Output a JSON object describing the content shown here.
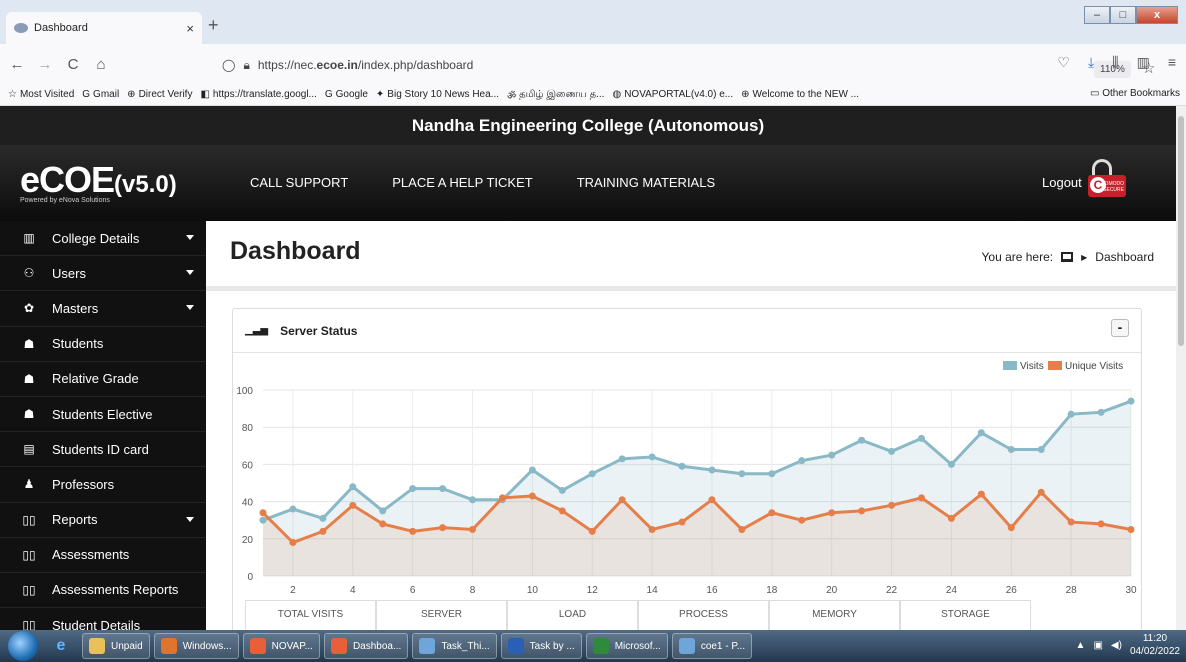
{
  "browser": {
    "tab_title": "Dashboard",
    "tab_close": "×",
    "new_tab": "+",
    "url_prefix": "https://nec.",
    "url_domain": "ecoe.in",
    "url_suffix": "/index.php/dashboard",
    "zoom": "110%",
    "bookmarks": [
      {
        "icon": "☆",
        "label": "Most Visited"
      },
      {
        "icon": "G",
        "label": "Gmail"
      },
      {
        "icon": "⊕",
        "label": "Direct Verify"
      },
      {
        "icon": "◧",
        "label": "https://translate.googl..."
      },
      {
        "icon": "G",
        "label": "Google"
      },
      {
        "icon": "✦",
        "label": "Big Story 10 News Hea..."
      },
      {
        "icon": "ॐ",
        "label": "தமிழ் இணைய த..."
      },
      {
        "icon": "◍",
        "label": "NOVAPORTAL(v4.0) e..."
      },
      {
        "icon": "⊕",
        "label": "Welcome to the NEW ..."
      }
    ],
    "other_bookmarks": "Other Bookmarks"
  },
  "header": {
    "college": "Nandha Engineering College (Autonomous)",
    "brand": "eCOE",
    "version": "(v5.0)",
    "powered": "Powered by eNova Solutions",
    "menu": [
      "CALL SUPPORT",
      "PLACE A HELP TICKET",
      "TRAINING MATERIALS"
    ],
    "logout": "Logout",
    "secure_badge": "COMODO SECURE"
  },
  "sidebar": {
    "items": [
      {
        "icon": "▥",
        "label": "College Details",
        "caret": true
      },
      {
        "icon": "⚇",
        "label": "Users",
        "caret": true
      },
      {
        "icon": "✿",
        "label": "Masters",
        "caret": true
      },
      {
        "icon": "☗",
        "label": "Students",
        "caret": false
      },
      {
        "icon": "☗",
        "label": "Relative Grade",
        "caret": false
      },
      {
        "icon": "☗",
        "label": "Students Elective",
        "caret": false
      },
      {
        "icon": "▤",
        "label": "Students ID card",
        "caret": false
      },
      {
        "icon": "♟",
        "label": "Professors",
        "caret": false
      },
      {
        "icon": "▯▯",
        "label": "Reports",
        "caret": true
      },
      {
        "icon": "▯▯",
        "label": "Assessments",
        "caret": false
      },
      {
        "icon": "▯▯",
        "label": "Assessments Reports",
        "caret": false
      },
      {
        "icon": "▯▯",
        "label": "Student Details",
        "caret": false
      }
    ]
  },
  "main": {
    "title": "Dashboard",
    "breadcrumb_prefix": "You are here:",
    "breadcrumb_current": "Dashboard",
    "panel_title": "Server Status",
    "collapse": "-",
    "stats": [
      "TOTAL VISITS",
      "SERVER",
      "LOAD",
      "PROCESS",
      "MEMORY",
      "STORAGE"
    ]
  },
  "chart_data": {
    "type": "area",
    "x": [
      1,
      2,
      3,
      4,
      5,
      6,
      7,
      8,
      9,
      10,
      11,
      12,
      13,
      14,
      15,
      16,
      17,
      18,
      19,
      20,
      21,
      22,
      23,
      24,
      25,
      26,
      27,
      28,
      29,
      30
    ],
    "series": [
      {
        "name": "Visits",
        "color": "#89b8c6",
        "values": [
          30,
          36,
          31,
          48,
          35,
          47,
          47,
          41,
          41,
          57,
          46,
          55,
          63,
          64,
          59,
          57,
          55,
          55,
          62,
          65,
          73,
          67,
          74,
          60,
          77,
          68,
          68,
          87,
          88,
          94
        ]
      },
      {
        "name": "Unique Visits",
        "color": "#e67e4a",
        "values": [
          34,
          18,
          24,
          38,
          28,
          24,
          26,
          25,
          42,
          43,
          35,
          24,
          41,
          25,
          29,
          41,
          25,
          34,
          30,
          34,
          35,
          38,
          42,
          31,
          44,
          26,
          45,
          29,
          28,
          25
        ]
      }
    ],
    "xticks": [
      2,
      4,
      6,
      8,
      10,
      12,
      14,
      16,
      18,
      20,
      22,
      24,
      26,
      28,
      30
    ],
    "yticks": [
      0,
      20,
      40,
      60,
      80,
      100
    ],
    "ylim": [
      0,
      100
    ],
    "xlim": [
      1,
      30
    ],
    "legend": "top-right",
    "grid": true
  },
  "taskbar": {
    "items": [
      {
        "label": "Unpaid",
        "color": "#e8c15a"
      },
      {
        "label": "Windows...",
        "color": "#e0742b"
      },
      {
        "label": "NOVAP...",
        "color": "#e8603a"
      },
      {
        "label": "Dashboa...",
        "color": "#e8603a"
      },
      {
        "label": "Task_Thi...",
        "color": "#6ea6d9"
      },
      {
        "label": "Task by ...",
        "color": "#2b5fb5"
      },
      {
        "label": "Microsof...",
        "color": "#2e8b3c"
      },
      {
        "label": "coe1 - P...",
        "color": "#6ea6d9"
      }
    ],
    "time": "11:20",
    "date": "04/02/2022"
  }
}
